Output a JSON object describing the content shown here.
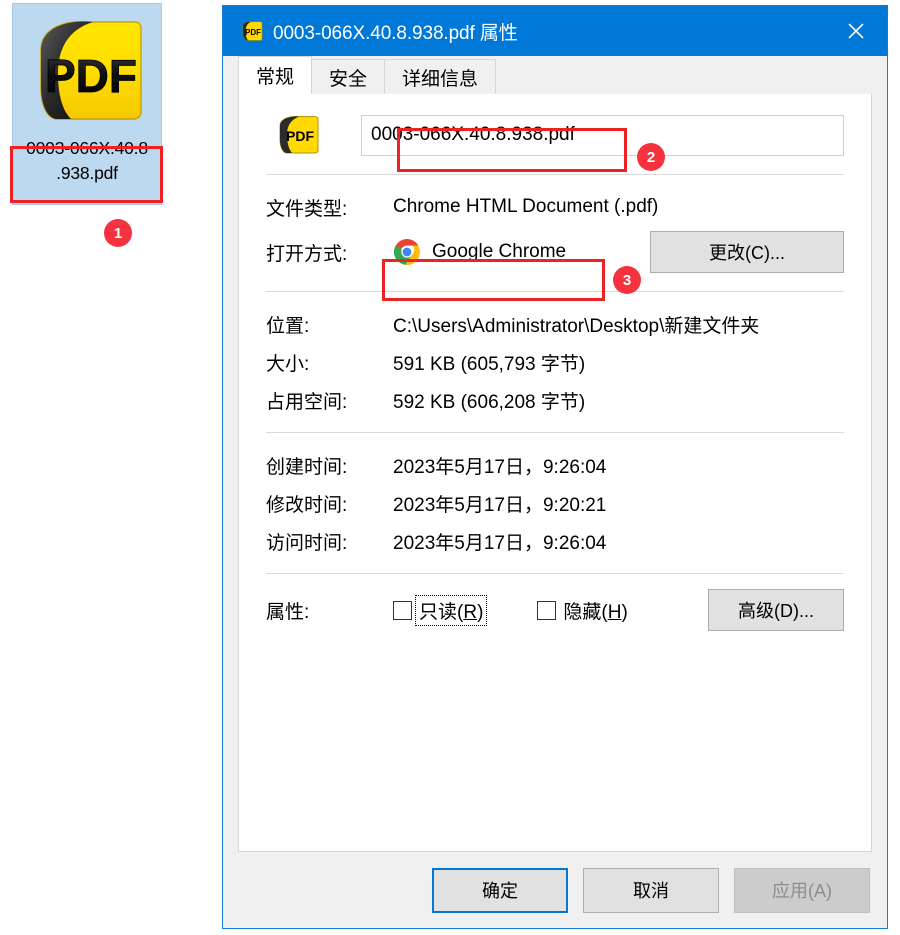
{
  "desktop": {
    "icon_label_line1": "0003-066X.40.8",
    "icon_label_line2": ".938.pdf",
    "badge": "1",
    "icon_type": "pdf-file-icon"
  },
  "dialog": {
    "title": "0003-066X.40.8.938.pdf 属性",
    "close_label": "✕",
    "tabs": [
      {
        "label": "常规",
        "active": true
      },
      {
        "label": "安全",
        "active": false
      },
      {
        "label": "详细信息",
        "active": false
      }
    ],
    "filename_value": "0003-066X.40.8.938.pdf",
    "filename_badge": "2",
    "rows": {
      "filetype_label": "文件类型:",
      "filetype_value": "Chrome HTML Document (.pdf)",
      "openwith_label": "打开方式:",
      "openwith_app": "Google Chrome",
      "openwith_badge": "3",
      "change_button": "更改(C)...",
      "location_label": "位置:",
      "location_value": "C:\\Users\\Administrator\\Desktop\\新建文件夹",
      "size_label": "大小:",
      "size_value": "591 KB (605,793 字节)",
      "disksize_label": "占用空间:",
      "disksize_value": "592 KB (606,208 字节)",
      "created_label": "创建时间:",
      "created_value": "2023年5月17日，9:26:04",
      "modified_label": "修改时间:",
      "modified_value": "2023年5月17日，9:20:21",
      "accessed_label": "访问时间:",
      "accessed_value": "2023年5月17日，9:26:04",
      "attributes_label": "属性:",
      "readonly_label_a": "只读(",
      "readonly_label_key": "R",
      "readonly_label_b": ")",
      "hidden_label_a": "隐藏(",
      "hidden_label_key": "H",
      "hidden_label_b": ")",
      "advanced_button": "高级(D)..."
    },
    "footer": {
      "ok": "确定",
      "cancel": "取消",
      "apply": "应用(A)"
    }
  },
  "colors": {
    "titlebar": "#0078d7",
    "accent": "#0078d7",
    "annotation_red": "#ee2222",
    "badge_red": "#f5333f",
    "selection_blue": "#bdd9f0"
  }
}
